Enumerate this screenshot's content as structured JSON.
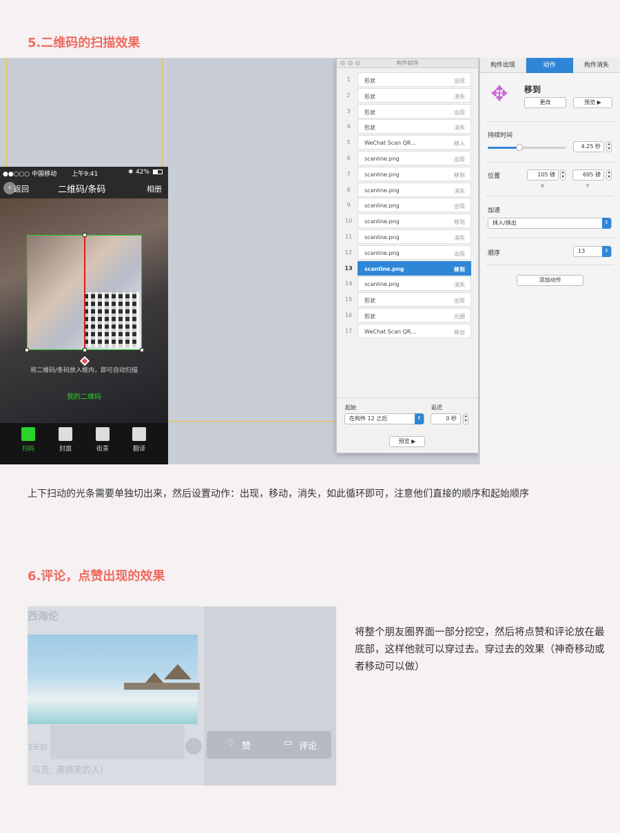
{
  "section5": {
    "title": "5.二维码的扫描效果",
    "description": "上下扫动的光条需要单独切出来，然后设置动作：出现，移动，消失，如此循环即可，注意他们直接的顺序和起始顺序"
  },
  "phone": {
    "carrier": "●●○○○ 中国移动",
    "time": "上午9:41",
    "battery": "42%",
    "back_label": "返回",
    "nav_title": "二维码/条码",
    "album_label": "相册",
    "hint": "将二维码/条码放入框内，即可自动扫描",
    "my_qr": "我的二维码",
    "tabs": [
      "扫码",
      "封面",
      "街景",
      "翻译"
    ]
  },
  "inspector": {
    "window_title": "构件顺序",
    "rows": [
      {
        "num": "1",
        "name": "形状",
        "action": "出现"
      },
      {
        "num": "2",
        "name": "形状",
        "action": "消失"
      },
      {
        "num": "3",
        "name": "形状",
        "action": "出现"
      },
      {
        "num": "4",
        "name": "形状",
        "action": "消失"
      },
      {
        "num": "5",
        "name": "WeChat Scan QR...",
        "action": "移入"
      },
      {
        "num": "6",
        "name": "scanline.png",
        "action": "出现"
      },
      {
        "num": "7",
        "name": "scanline.png",
        "action": "移到"
      },
      {
        "num": "8",
        "name": "scanline.png",
        "action": "消失"
      },
      {
        "num": "9",
        "name": "scanline.png",
        "action": "出现"
      },
      {
        "num": "10",
        "name": "scanline.png",
        "action": "移到"
      },
      {
        "num": "11",
        "name": "scanline.png",
        "action": "消失"
      },
      {
        "num": "12",
        "name": "scanline.png",
        "action": "出现"
      },
      {
        "num": "13",
        "name": "scanline.png",
        "action": "移到"
      },
      {
        "num": "14",
        "name": "scanline.png",
        "action": "消失"
      },
      {
        "num": "15",
        "name": "形状",
        "action": "出现"
      },
      {
        "num": "16",
        "name": "形状",
        "action": "光圈"
      },
      {
        "num": "17",
        "name": "WeChat Scan QR...",
        "action": "移出"
      }
    ],
    "selected_index": 12,
    "start_label": "起始",
    "start_value": "在构件 12 之后",
    "delay_label": "延迟",
    "delay_value": "0 秒",
    "preview_label": "预览 ▶"
  },
  "panel": {
    "tabs": [
      "构件出现",
      "动作",
      "构件消失"
    ],
    "active_tab": 1,
    "action_name": "移到",
    "change_label": "更改",
    "preview_label": "预览 ▶",
    "duration_label": "持续时间",
    "duration_value": "4.25 秒",
    "duration_fraction": 0.4,
    "position_label": "位置",
    "pos_x": "105 磅",
    "pos_y": "695 磅",
    "x_cap": "X",
    "y_cap": "Y",
    "accel_label": "加速",
    "accel_value": "抹入/抹出",
    "order_label": "顺序",
    "order_value": "13",
    "add_action_label": "添加动作"
  },
  "section6": {
    "title": "6.评论，点赞出现的效果",
    "description": "将整个朋友圈界面一部分挖空，然后将点赞和评论放在最底部，这样他就可以穿过去。穿过去的效果（神奇移动或者移动可以做）",
    "moments_name": "西海伦",
    "time_ago": "3天前",
    "like_label": "赞",
    "comment_label": "评论",
    "comment_text": "马克: 满搞笑的人!"
  },
  "colors": {
    "title": "#f06a5f",
    "accent": "#2f86d6",
    "guide": "#e4c43a",
    "scan_green": "#2bd22b",
    "scanline_red": "#e01818"
  }
}
